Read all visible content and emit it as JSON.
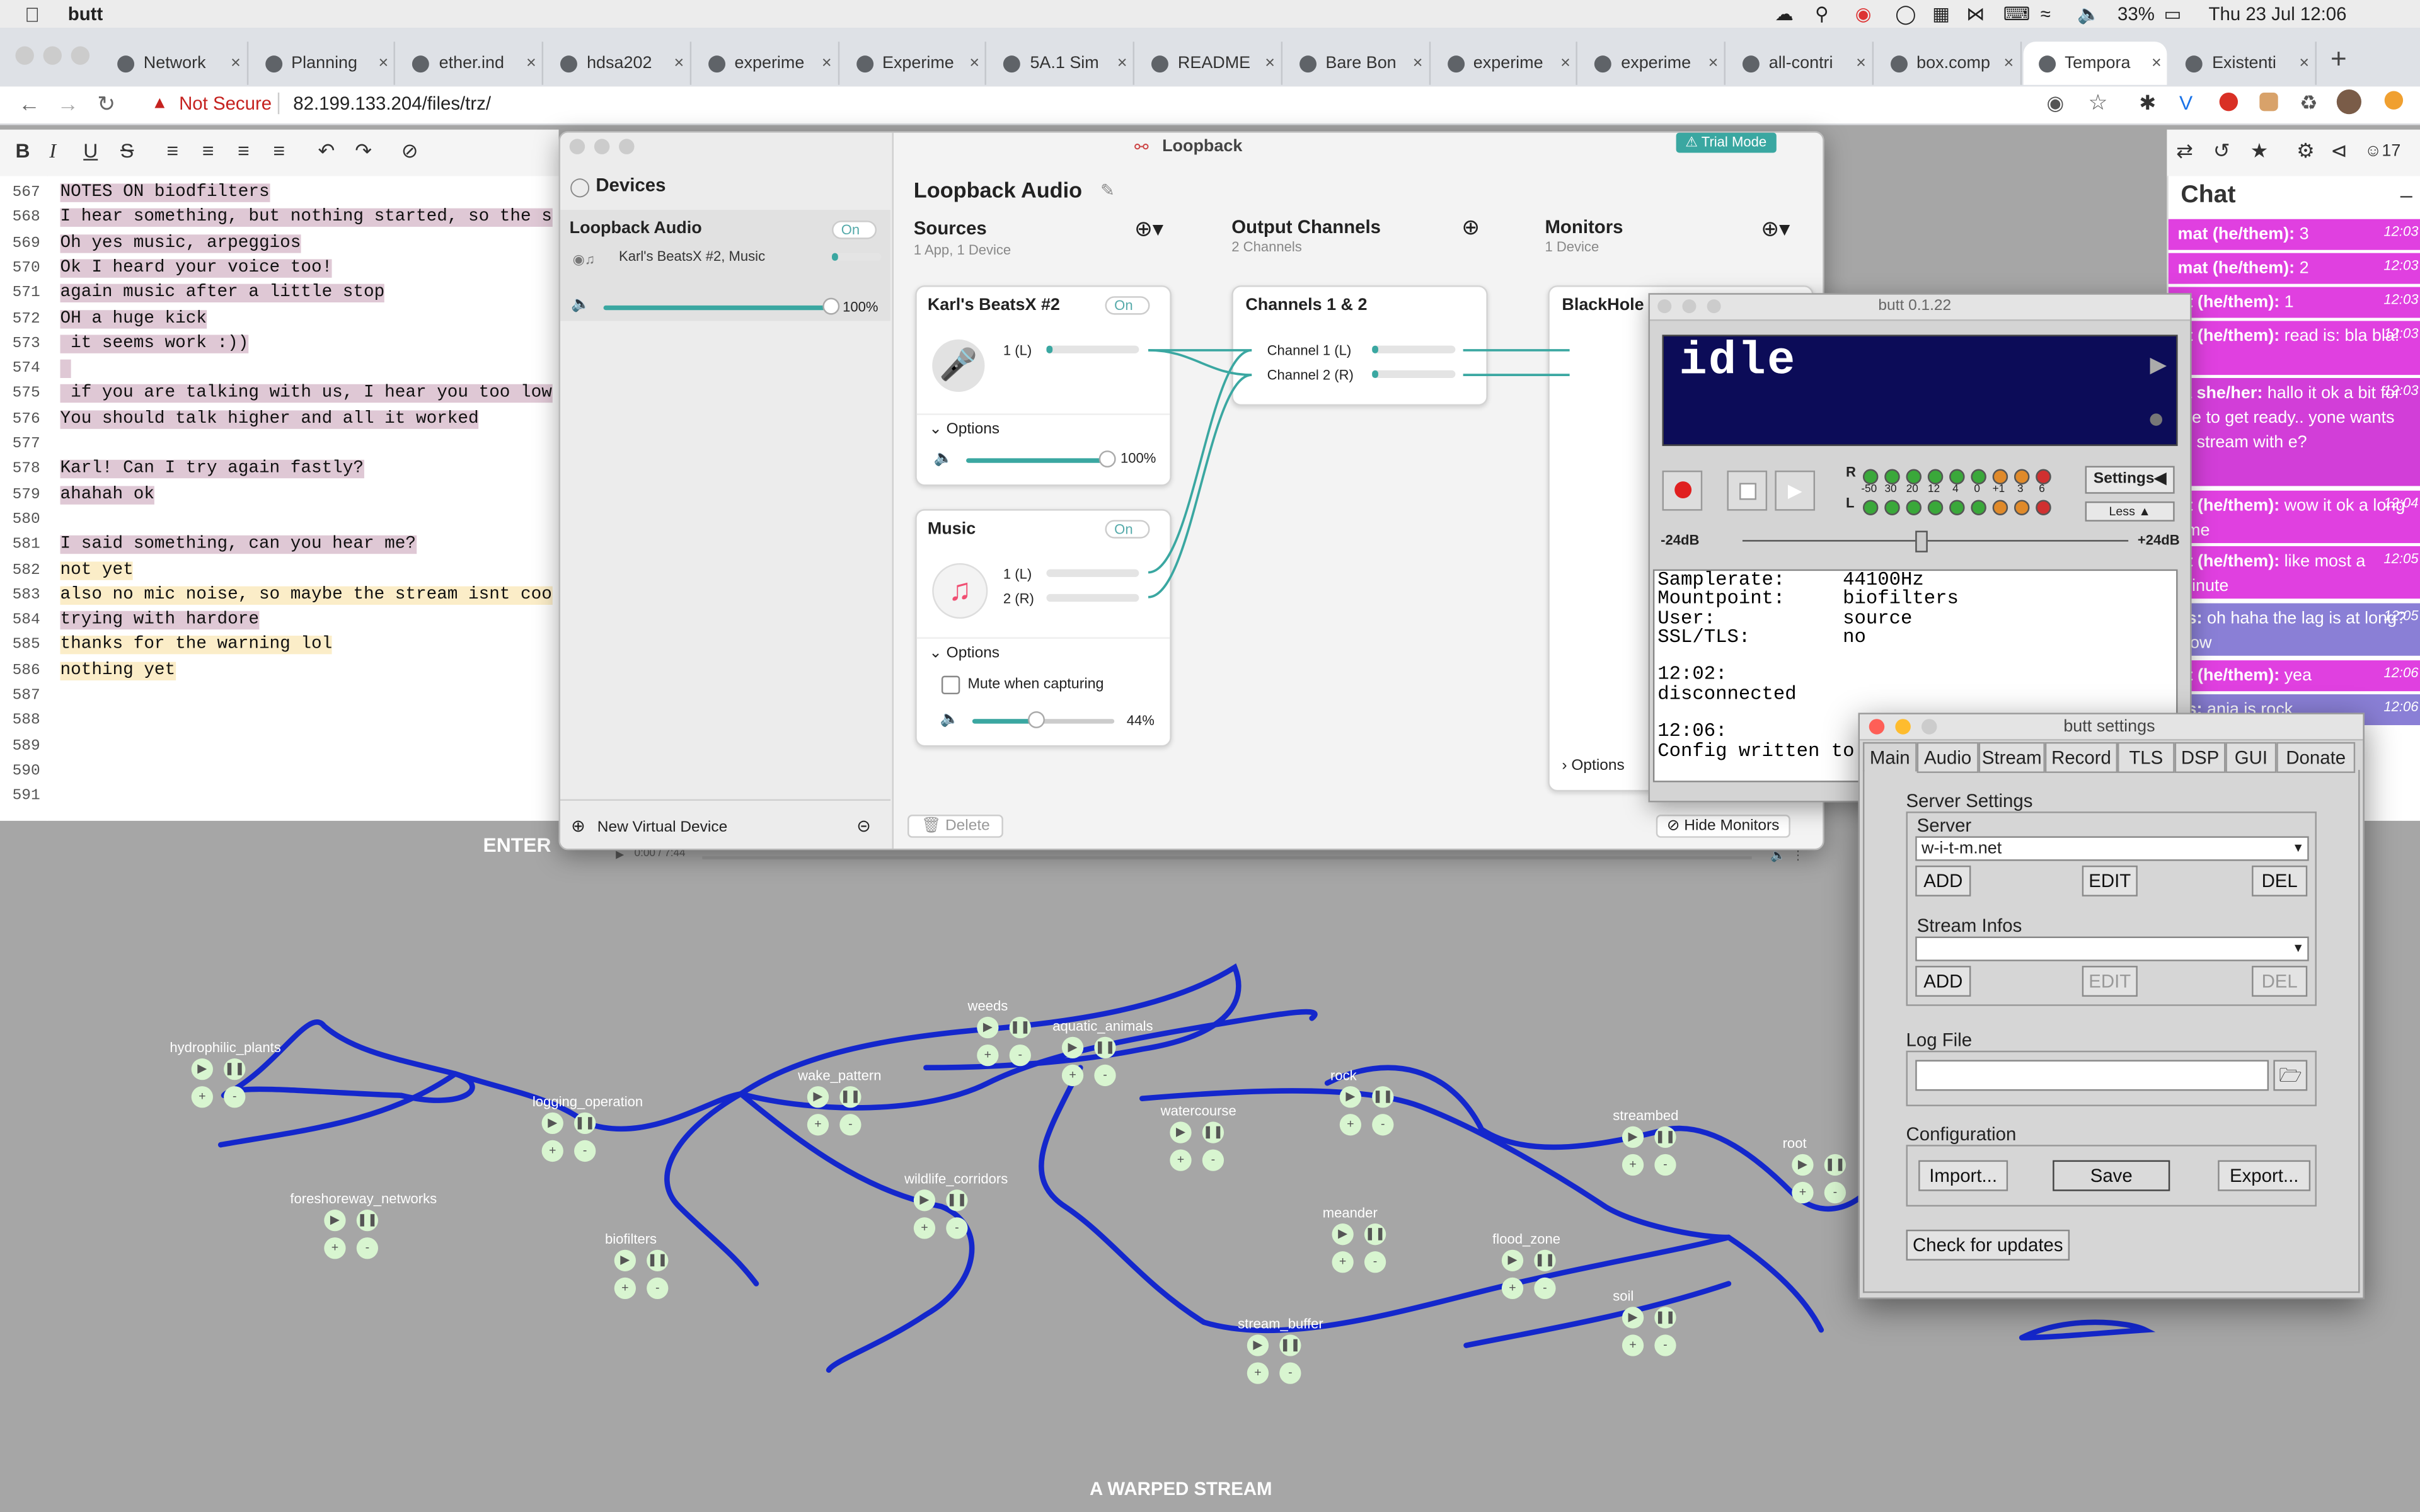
{
  "menubar": {
    "app": "butt",
    "battery": "33%",
    "datetime": "Thu 23 Jul  12:06"
  },
  "browser": {
    "tabs": [
      {
        "label": "Network"
      },
      {
        "label": "Planning"
      },
      {
        "label": "ether.ind"
      },
      {
        "label": "hdsa202"
      },
      {
        "label": "experime"
      },
      {
        "label": "Experime"
      },
      {
        "label": "5A.1 Sim"
      },
      {
        "label": "README"
      },
      {
        "label": "Bare Bon"
      },
      {
        "label": "experime"
      },
      {
        "label": "experime"
      },
      {
        "label": "all-contri"
      },
      {
        "label": "box.comp"
      },
      {
        "label": "Tempora"
      },
      {
        "label": "Existenti"
      }
    ],
    "security": "Not Secure",
    "url": "82.199.133.204/files/trz/"
  },
  "editor": {
    "lines": [
      {
        "n": "567",
        "t": "NOTES ON biodfilters",
        "hl": "p"
      },
      {
        "n": "568",
        "t": "I hear something, but nothing started, so the s",
        "hl": "p"
      },
      {
        "n": "569",
        "t": "Oh yes music, arpeggios",
        "hl": "p"
      },
      {
        "n": "570",
        "t": "Ok I heard your voice too!",
        "hl": "p"
      },
      {
        "n": "571",
        "t": "again music after a little stop",
        "hl": "p"
      },
      {
        "n": "572",
        "t": "OH a huge kick",
        "hl": "p"
      },
      {
        "n": "573",
        "t": " it seems work :))",
        "hl": "p"
      },
      {
        "n": "574",
        "t": " ",
        "hl": "p"
      },
      {
        "n": "575",
        "t": " if you are talking with us, I hear you too low",
        "hl": "p"
      },
      {
        "n": "576",
        "t": "You should talk higher and all it worked",
        "hl": "p"
      },
      {
        "n": "577",
        "t": "",
        "hl": ""
      },
      {
        "n": "578",
        "t": "Karl! Can I try again fastly?",
        "hl": "p"
      },
      {
        "n": "579",
        "t": "ahahah ok",
        "hl": "p"
      },
      {
        "n": "580",
        "t": "",
        "hl": ""
      },
      {
        "n": "581",
        "t": "I said something, can you hear me?",
        "hl": "p"
      },
      {
        "n": "582",
        "t": "not yet",
        "hl": "y"
      },
      {
        "n": "583",
        "t": "also no mic noise, so maybe the stream isnt coo",
        "hl": "y"
      },
      {
        "n": "584",
        "t": "trying with hardore",
        "hl": "p"
      },
      {
        "n": "585",
        "t": "thanks for the warning lol",
        "hl": "y"
      },
      {
        "n": "586",
        "t": "nothing yet",
        "hl": "y"
      },
      {
        "n": "587",
        "t": "",
        "hl": ""
      },
      {
        "n": "588",
        "t": "",
        "hl": ""
      },
      {
        "n": "589",
        "t": "",
        "hl": ""
      },
      {
        "n": "590",
        "t": "",
        "hl": ""
      },
      {
        "n": "591",
        "t": "",
        "hl": ""
      }
    ]
  },
  "chat": {
    "title": "Chat",
    "user_count": "17",
    "messages": [
      {
        "who": "mat (he/them):",
        "text": " 3",
        "time": "12:03",
        "color": "#e040e0"
      },
      {
        "who": "mat (he/them):",
        "text": " 2",
        "time": "12:03",
        "color": "#e040e0"
      },
      {
        "who": "at (he/them):",
        "text": " 1",
        "time": "12:03",
        "color": "#e040e0"
      },
      {
        "who": "at (he/them):",
        "text": " read is: bla bla!",
        "time": "12:03",
        "color": "#e040e0"
      },
      {
        "who": "ja she/her:",
        "text": " hallo it ok a bit for me to get ready.. yone wants to stream with e?",
        "time": "12:03",
        "color": "#d23ed8"
      },
      {
        "who": "at (he/them):",
        "text": " wow it ok a long time",
        "time": "12:04",
        "color": "#e040e0"
      },
      {
        "who": "at (he/them):",
        "text": " like most a minute",
        "time": "12:05",
        "color": "#e040e0"
      },
      {
        "who": "es:",
        "text": " oh haha the lag is at long? wow",
        "time": "12:05",
        "color": "#8a7fd6"
      },
      {
        "who": "at (he/them):",
        "text": " yea",
        "time": "12:06",
        "color": "#e040e0"
      },
      {
        "who": "es:",
        "text": " anja is rock",
        "time": "12:06",
        "color": "#8a7fd6"
      }
    ]
  },
  "loopback": {
    "title": "Loopback",
    "trial": "Trial Mode",
    "devices_heading": "Devices",
    "device": {
      "name": "Loopback Audio",
      "sub": "Karl's BeatsX #2, Music",
      "switch": "On",
      "volume": "100%"
    },
    "new_device": "New Virtual Device",
    "main_title": "Loopback Audio",
    "sources": {
      "title": "Sources",
      "sub": "1 App, 1 Device"
    },
    "outputs": {
      "title": "Output Channels",
      "sub": "2 Channels"
    },
    "monitors": {
      "title": "Monitors",
      "sub": "1 Device"
    },
    "source1": {
      "name": "Karl's BeatsX #2",
      "switch": "On",
      "ch1": "1 (L)",
      "options": "Options",
      "volume": "100%"
    },
    "source2": {
      "name": "Music",
      "switch": "On",
      "ch1": "1 (L)",
      "ch2": "2 (R)",
      "options": "Options",
      "mute": "Mute when capturing",
      "volume": "44%"
    },
    "channels": {
      "name": "Channels 1 & 2",
      "c1": "Channel 1 (L)",
      "c2": "Channel 2 (R)"
    },
    "monitor": {
      "name": "BlackHole",
      "options": "Options"
    },
    "delete": "Delete",
    "hide": "Hide Monitors"
  },
  "butt": {
    "title": "butt 0.1.22",
    "status": "idle",
    "settings_btn": "Settings",
    "less_btn": "Less",
    "vu_r": "R",
    "vu_l": "L",
    "vu_scale": [
      "-50",
      "30",
      "20",
      "12",
      "4",
      "0",
      "+1",
      "3",
      "6"
    ],
    "gain_min": "-24dB",
    "gain_max": "+24dB",
    "log": [
      "Samplerate:     44100Hz",
      "Mountpoint:     biofilters",
      "User:           source",
      "SSL/TLS:        no",
      "",
      "12:02:",
      "disconnected",
      "",
      "12:06:",
      "Config written to"
    ]
  },
  "butt_settings": {
    "title": "butt settings",
    "tabs": [
      "Main",
      "Audio",
      "Stream",
      "Record",
      "TLS",
      "DSP",
      "GUI",
      "Donate"
    ],
    "server_settings": "Server Settings",
    "server_label": "Server",
    "server_value": "w-i-t-m.net",
    "add": "ADD",
    "edit": "EDIT",
    "del": "DEL",
    "stream_infos": "Stream Infos",
    "log_file": "Log File",
    "configuration": "Configuration",
    "import": "Import...",
    "save": "Save",
    "export": "Export...",
    "updates": "Check for updates"
  },
  "stream": {
    "enter": "ENTER",
    "title": "A WARPED STREAM",
    "player_time": "0:00 / 7:44",
    "nodes": [
      "hydrophilic_plants",
      "logging_operation",
      "foreshoreway_networks",
      "biofilters",
      "weeds",
      "aquatic_animals",
      "wake_pattern",
      "wildlife_corridors",
      "watercourse",
      "rock",
      "meander",
      "stream_buffer",
      "flood_zone",
      "soil",
      "streambed",
      "root"
    ]
  }
}
